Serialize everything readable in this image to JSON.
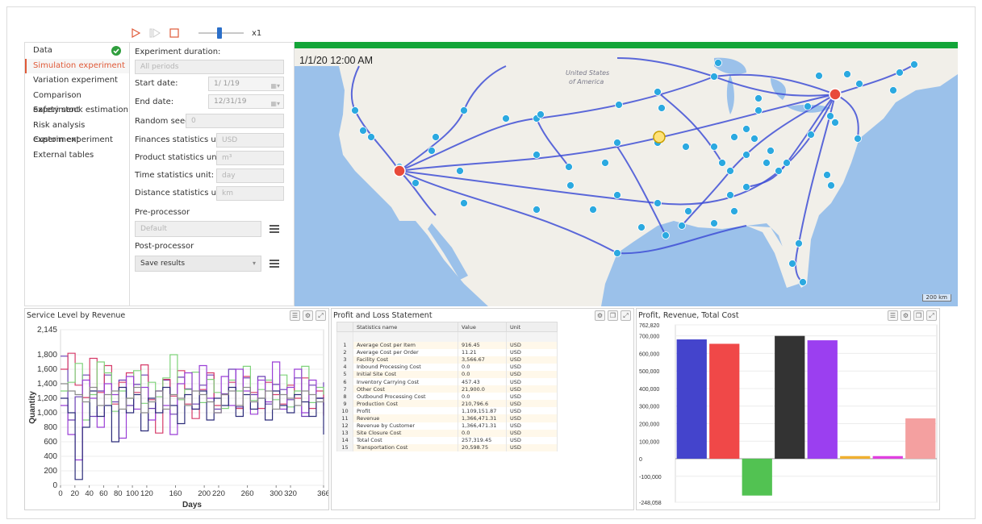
{
  "toolbar": {
    "play_icon": "play-icon",
    "step_icon": "step-forward-icon",
    "stop_icon": "stop-icon",
    "speed_fraction": 0.45,
    "speed_label": "x1",
    "accent": "#e05a38"
  },
  "nav": {
    "items": [
      {
        "label": "Data",
        "status": "complete"
      },
      {
        "label": "Simulation experiment"
      },
      {
        "label": "Variation experiment"
      },
      {
        "label": "Comparison experiment"
      },
      {
        "label": "Safety stock estimation"
      },
      {
        "label": "Risk analysis experiment"
      },
      {
        "label": "Custom experiment"
      },
      {
        "label": "External tables"
      }
    ],
    "active_index": 1
  },
  "form": {
    "duration_label": "Experiment duration:",
    "duration_value": "All periods",
    "start_label": "Start date:",
    "start_value": "1/ 1/19",
    "end_label": "End date:",
    "end_value": "12/31/19",
    "seed_label": "Random seed:",
    "seed_value": "0",
    "fin_label": "Finances statistics unit:",
    "fin_value": "USD",
    "prod_label": "Product statistics unit:",
    "prod_value": "m³",
    "time_label": "Time statistics unit:",
    "time_value": "day",
    "dist_label": "Distance statistics unit:",
    "dist_value": "km",
    "pre_label": "Pre-processor",
    "pre_value": "Default",
    "post_label": "Post-processor",
    "post_value": "Save results"
  },
  "map": {
    "timestamp": "1/1/20 12:00 AM",
    "country_label_1": "United States",
    "country_label_2": "of America",
    "scale_label": "200 km",
    "progress_color": "#13a538",
    "water_color": "#9bc1ea",
    "land_color": "#f1efe9"
  },
  "service_chart": {
    "title": "Service Level by Revenue",
    "chart_data": {
      "type": "line",
      "xlabel": "Days",
      "ylabel": "Quantity",
      "xlim": [
        0,
        366
      ],
      "ylim": [
        0,
        2145
      ],
      "x_ticks": [
        0,
        20,
        40,
        60,
        80,
        100,
        120,
        160,
        200,
        220,
        260,
        300,
        320,
        366
      ],
      "y_ticks": [
        0,
        200,
        400,
        600,
        800,
        1000,
        1200,
        1400,
        1600,
        1800,
        2145
      ],
      "series": [
        {
          "color": "#6a3fb5",
          "values": [
            1780,
            900,
            1220,
            1520,
            950,
            1300,
            1520,
            1150,
            1450,
            1100,
            1390,
            1520,
            1060,
            1300,
            1450,
            980,
            1490,
            1330,
            1120,
            1380,
            1520,
            1050,
            1260,
            1600,
            1080,
            1480,
            1250,
            1500,
            1120,
            1390,
            1320,
            1180,
            1480,
            950,
            1380,
            1200,
            1420
          ]
        },
        {
          "color": "#d63a68",
          "values": [
            1600,
            1820,
            1380,
            1210,
            1750,
            1280,
            1650,
            1120,
            1420,
            1550,
            1280,
            1660,
            1180,
            720,
            1460,
            1230,
            1580,
            1120,
            920,
            1320,
            1550,
            1100,
            1250,
            1420,
            1060,
            1500,
            1280,
            1060,
            1420,
            1250,
            1120,
            1380,
            1200,
            1480,
            1060,
            1300,
            960
          ]
        },
        {
          "color": "#7fd37a",
          "values": [
            1300,
            1420,
            1680,
            900,
            1250,
            1700,
            1550,
            1020,
            1300,
            1200,
            1580,
            1130,
            1420,
            1220,
            1480,
            1800,
            1180,
            1320,
            1560,
            1140,
            1460,
            1280,
            1060,
            1450,
            1300,
            1640,
            1170,
            1320,
            1450,
            1180,
            1520,
            1080,
            1300,
            1640,
            1140,
            1350,
            1250
          ]
        },
        {
          "color": "#9a3fd6",
          "values": [
            1100,
            700,
            350,
            1450,
            1200,
            800,
            1400,
            1250,
            650,
            1500,
            1050,
            1350,
            900,
            1300,
            1100,
            700,
            1400,
            1550,
            1050,
            1650,
            1200,
            1000,
            1500,
            1100,
            1600,
            1300,
            980,
            1450,
            1150,
            1700,
            1050,
            1350,
            1600,
            1000,
            1450,
            1200,
            1100
          ]
        },
        {
          "color": "#2c2c7a",
          "values": [
            1200,
            1000,
            80,
            800,
            1300,
            950,
            1100,
            600,
            1350,
            1000,
            1250,
            750,
            1200,
            1000,
            1350,
            1100,
            850,
            1250,
            1050,
            1300,
            900,
            1200,
            1100,
            1350,
            950,
            1250,
            1050,
            1200,
            900,
            1300,
            1100,
            1000,
            1250,
            1150,
            950,
            1200,
            700
          ]
        },
        {
          "color": "#8a8a8a",
          "values": [
            1400,
            1300,
            1250,
            1150,
            1350,
            1100,
            1250,
            1300,
            1050,
            1200,
            1350,
            1000,
            1150,
            1300,
            1050,
            1250,
            1200,
            1100,
            1300,
            1250,
            1150,
            1000,
            1250,
            1300,
            1100,
            1350,
            1150,
            1200,
            1300,
            1050,
            1250,
            1200,
            1100,
            1300,
            1250,
            1150,
            1200
          ]
        }
      ]
    }
  },
  "pl_table": {
    "title": "Profit and Loss Statement",
    "headers": [
      "",
      "Statistics name",
      "Value",
      "Unit"
    ],
    "rows": [
      [
        "1",
        "Average Cost per Item",
        "916.45",
        "USD"
      ],
      [
        "2",
        "Average Cost per Order",
        "11.21",
        "USD"
      ],
      [
        "3",
        "Facility Cost",
        "3,566.67",
        "USD"
      ],
      [
        "4",
        "Inbound Processing Cost",
        "0.0",
        "USD"
      ],
      [
        "5",
        "Initial Site Cost",
        "0.0",
        "USD"
      ],
      [
        "6",
        "Inventory Carrying Cost",
        "457.43",
        "USD"
      ],
      [
        "7",
        "Other Cost",
        "21,900.0",
        "USD"
      ],
      [
        "8",
        "Outbound Processing Cost",
        "0.0",
        "USD"
      ],
      [
        "9",
        "Production Cost",
        "210,796.6",
        "USD"
      ],
      [
        "10",
        "Profit",
        "1,109,151.87",
        "USD"
      ],
      [
        "11",
        "Revenue",
        "1,366,471.31",
        "USD"
      ],
      [
        "12",
        "Revenue by Customer",
        "1,366,471.31",
        "USD"
      ],
      [
        "13",
        "Site Closure Cost",
        "0.0",
        "USD"
      ],
      [
        "14",
        "Total Cost",
        "257,319.45",
        "USD"
      ],
      [
        "15",
        "Transportation Cost",
        "20,598.75",
        "USD"
      ]
    ]
  },
  "bar_chart": {
    "title": "Profit, Revenue, Total Cost",
    "chart_data": {
      "type": "bar",
      "ylim": [
        -248058,
        762820
      ],
      "y_ticks": [
        "762,820",
        "700,000",
        "600,000",
        "500,000",
        "400,000",
        "300,000",
        "200,000",
        "100,000",
        "0",
        "-100,000",
        "-248,058"
      ],
      "y_tick_values": [
        762820,
        700000,
        600000,
        500000,
        400000,
        300000,
        200000,
        100000,
        0,
        -100000,
        -248058
      ],
      "values": [
        680000,
        655000,
        -210000,
        700000,
        675000,
        15000,
        15000,
        230000
      ],
      "colors": [
        "#4444cc",
        "#f04848",
        "#52c252",
        "#333333",
        "#9b3ff0",
        "#f0b030",
        "#e040e0",
        "#f4a0a0"
      ]
    }
  }
}
